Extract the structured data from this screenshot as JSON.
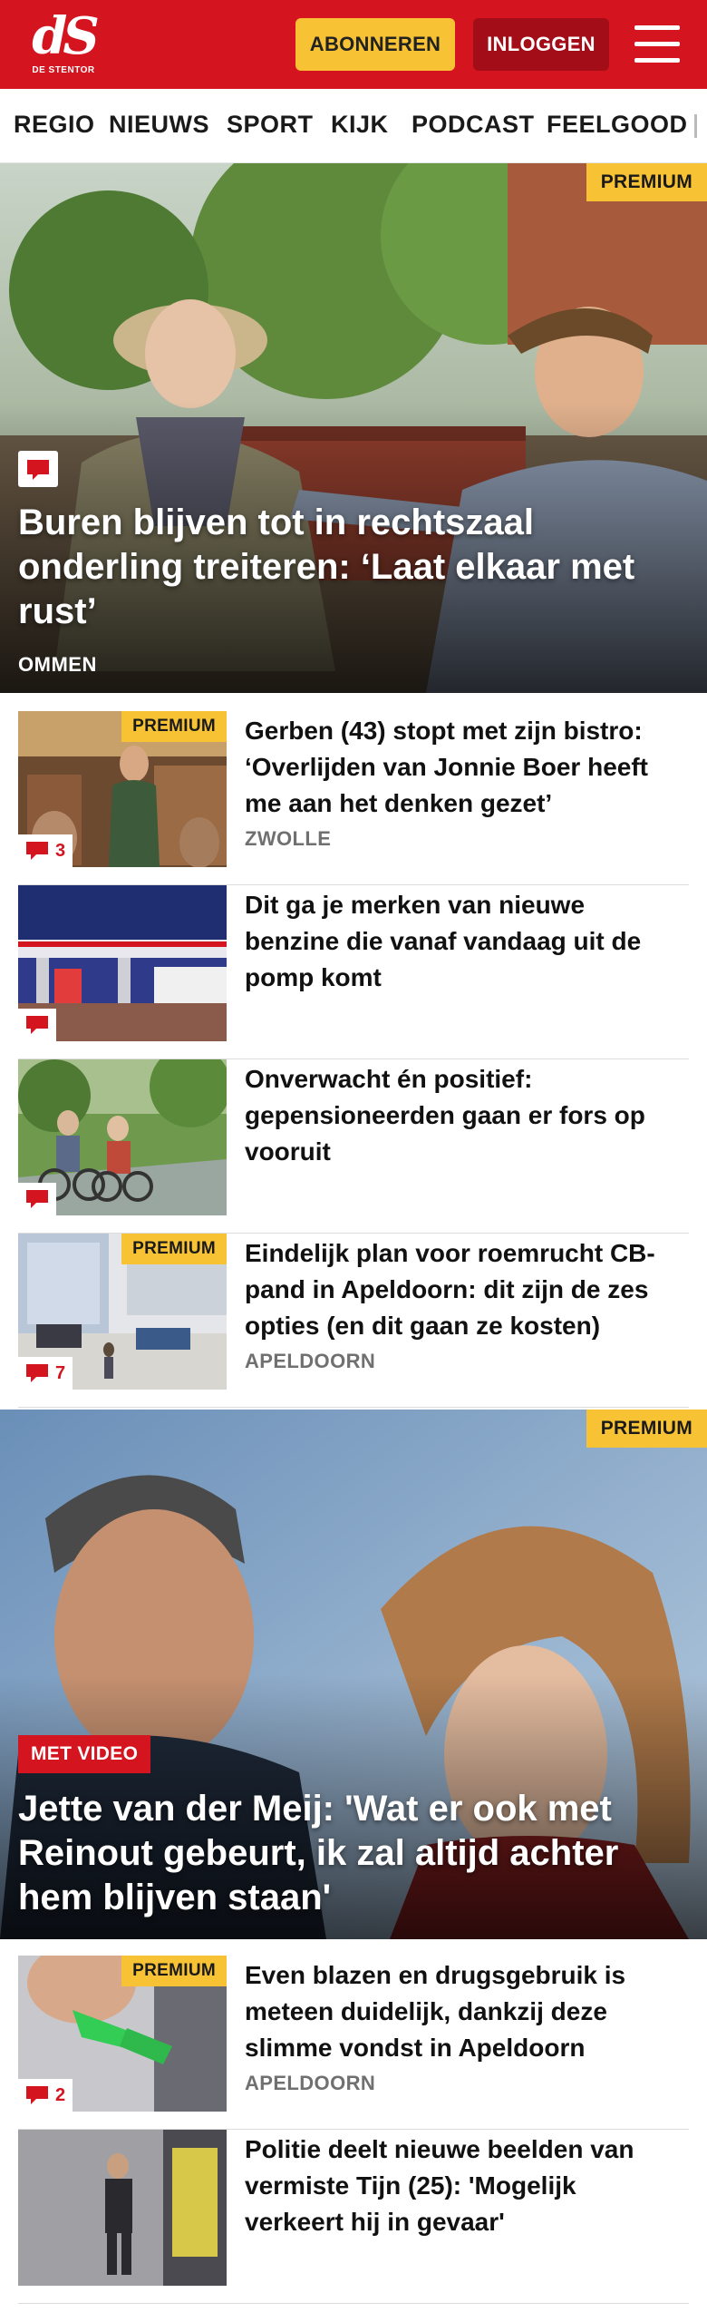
{
  "header": {
    "logo_mark": "dS",
    "logo_sub": "DE STENTOR",
    "subscribe_label": "ABONNEREN",
    "login_label": "INLOGGEN",
    "menu_icon": "hamburger-menu-icon",
    "brand_color": "#d4141e",
    "accent_color": "#f7c233"
  },
  "nav": {
    "items": [
      {
        "label": "REGIO"
      },
      {
        "label": "NIEUWS"
      },
      {
        "label": "SPORT"
      },
      {
        "label": "KIJK"
      },
      {
        "label": "PODCAST"
      },
      {
        "label": "FEELGOOD"
      }
    ]
  },
  "hero1": {
    "badge": "PREMIUM",
    "icon": "comment-icon",
    "title": "Buren blijven tot in rechtszaal onderling treiteren: ‘Laat elkaar met rust’",
    "location": "OMMEN"
  },
  "articles_a": [
    {
      "title": "Gerben (43) stopt met zijn bistro: ‘Overlijden van Jonnie Boer heeft me aan het denken gezet’",
      "location": "ZWOLLE",
      "premium": "PREMIUM",
      "comments": "3"
    },
    {
      "title": "Dit ga je merken van nieuwe benzine die vanaf vandaag uit de pomp komt",
      "location": "",
      "premium": "",
      "comments": ""
    },
    {
      "title": "Onverwacht én positief: gepensioneerden gaan er fors op vooruit",
      "location": "",
      "premium": "",
      "comments": ""
    },
    {
      "title": "Eindelijk plan voor roemrucht CB-pand in Apeldoorn: dit zijn de zes opties (en dit gaan ze kosten)",
      "location": "APELDOORN",
      "premium": "PREMIUM",
      "comments": "7"
    }
  ],
  "hero2": {
    "badge": "PREMIUM",
    "video_badge": "MET VIDEO",
    "title": "Jette van der Meij: 'Wat er ook met Reinout gebeurt, ik zal altijd achter hem blijven staan'"
  },
  "articles_b": [
    {
      "title": "Even blazen en drugsgebruik is meteen duidelijk, dankzij deze slimme vondst in Apeldoorn",
      "location": "APELDOORN",
      "premium": "PREMIUM",
      "comments": "2"
    },
    {
      "title": "Politie deelt nieuwe beelden van vermiste Tijn (25): 'Mogelijk verkeert hij in gevaar'",
      "location": "",
      "premium": "",
      "comments": ""
    }
  ]
}
